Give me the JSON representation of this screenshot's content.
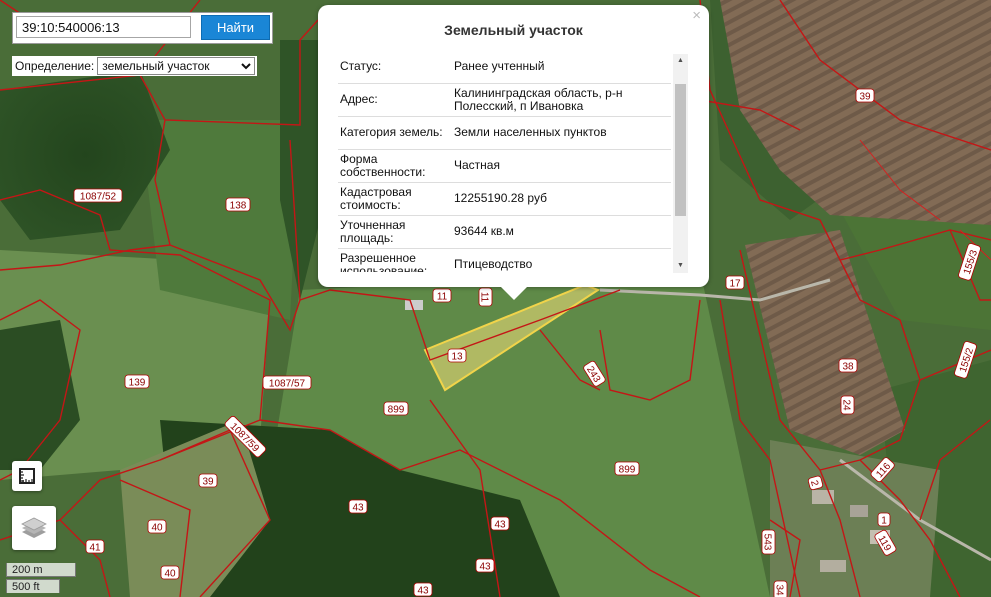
{
  "search": {
    "value": "39:10:540006:13",
    "button_label": "Найти"
  },
  "definition": {
    "label": "Определение:",
    "selected": "земельный участок"
  },
  "popup": {
    "title": "Земельный участок",
    "close_symbol": "×",
    "rows": [
      {
        "key": "Статус:",
        "value": "Ранее учтенный"
      },
      {
        "key": "Адрес:",
        "value": "Калининградская область, р-н Полесский, п Ивановка"
      },
      {
        "key": "Категория земель:",
        "value": "Земли населенных пунктов"
      },
      {
        "key": "Форма собственности:",
        "value": "Частная"
      },
      {
        "key": "Кадастровая стоимость:",
        "value": "12255190.28 руб"
      },
      {
        "key": "Уточненная площадь:",
        "value": "93644 кв.м"
      },
      {
        "key": "Разрешенное использование:",
        "value": "Птицеводство"
      }
    ]
  },
  "map": {
    "highlight_color": "#f2e07a",
    "boundary_color": "#c41616",
    "parcel_labels": [
      "39",
      "1087/52",
      "138",
      "139",
      "1087/57",
      "899",
      "899",
      "11",
      "11",
      "13",
      "243",
      "17",
      "155/3",
      "155/2",
      "38",
      "24",
      "116",
      "2",
      "1087/59",
      "39",
      "40",
      "40",
      "41",
      "43",
      "43",
      "43",
      "43",
      "1",
      "119",
      "543",
      "34"
    ]
  },
  "controls": {
    "measure_icon": "ruler-icon",
    "layers_icon": "layers-icon"
  },
  "scale": {
    "metric": "200 m",
    "imperial": "500 ft"
  }
}
